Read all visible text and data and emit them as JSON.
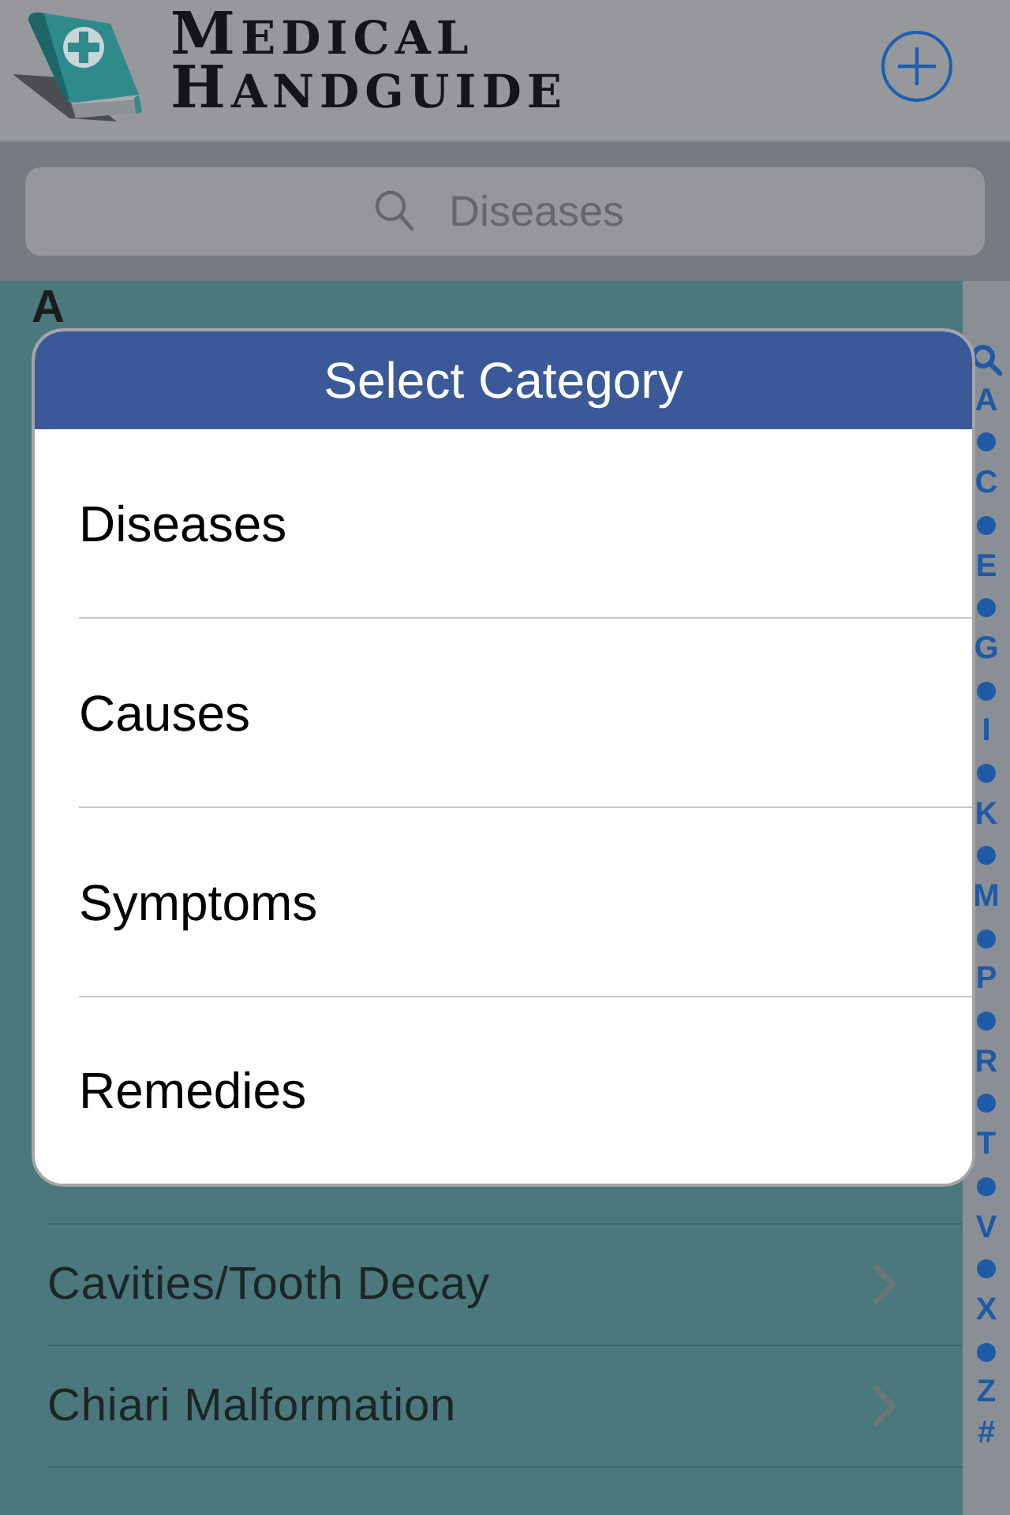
{
  "header": {
    "logo_lines": [
      "MEDICAL",
      "HANDGUIDE"
    ]
  },
  "search": {
    "placeholder": "Diseases"
  },
  "list": {
    "section": "A",
    "rows": [
      {
        "title": "Cavities/Tooth Decay"
      },
      {
        "title": "Chiari Malformation"
      }
    ]
  },
  "index": [
    {
      "kind": "search"
    },
    {
      "kind": "letter",
      "label": "A"
    },
    {
      "kind": "dot"
    },
    {
      "kind": "letter",
      "label": "C"
    },
    {
      "kind": "dot"
    },
    {
      "kind": "letter",
      "label": "E"
    },
    {
      "kind": "dot"
    },
    {
      "kind": "letter",
      "label": "G"
    },
    {
      "kind": "dot"
    },
    {
      "kind": "letter",
      "label": "I"
    },
    {
      "kind": "dot"
    },
    {
      "kind": "letter",
      "label": "K"
    },
    {
      "kind": "dot"
    },
    {
      "kind": "letter",
      "label": "M"
    },
    {
      "kind": "dot"
    },
    {
      "kind": "letter",
      "label": "P"
    },
    {
      "kind": "dot"
    },
    {
      "kind": "letter",
      "label": "R"
    },
    {
      "kind": "dot"
    },
    {
      "kind": "letter",
      "label": "T"
    },
    {
      "kind": "dot"
    },
    {
      "kind": "letter",
      "label": "V"
    },
    {
      "kind": "dot"
    },
    {
      "kind": "letter",
      "label": "X"
    },
    {
      "kind": "dot"
    },
    {
      "kind": "letter",
      "label": "Z"
    },
    {
      "kind": "letter",
      "label": "#"
    }
  ],
  "dialog": {
    "title": "Select Category",
    "options": [
      "Diseases",
      "Causes",
      "Symptoms",
      "Remedies"
    ]
  }
}
